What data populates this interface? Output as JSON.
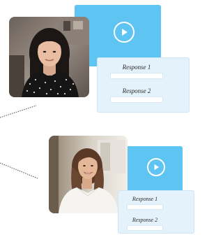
{
  "card1": {
    "play_icon": "play-icon",
    "responses": [
      {
        "label": "Response 1"
      },
      {
        "label": "Response 2"
      }
    ]
  },
  "card2": {
    "play_icon": "play-icon",
    "responses": [
      {
        "label": "Response 1"
      },
      {
        "label": "Response 2"
      }
    ]
  },
  "colors": {
    "video_blue": "#5ec4f2",
    "response_bg": "#e4f2fb",
    "field_bg": "#ffffff"
  }
}
